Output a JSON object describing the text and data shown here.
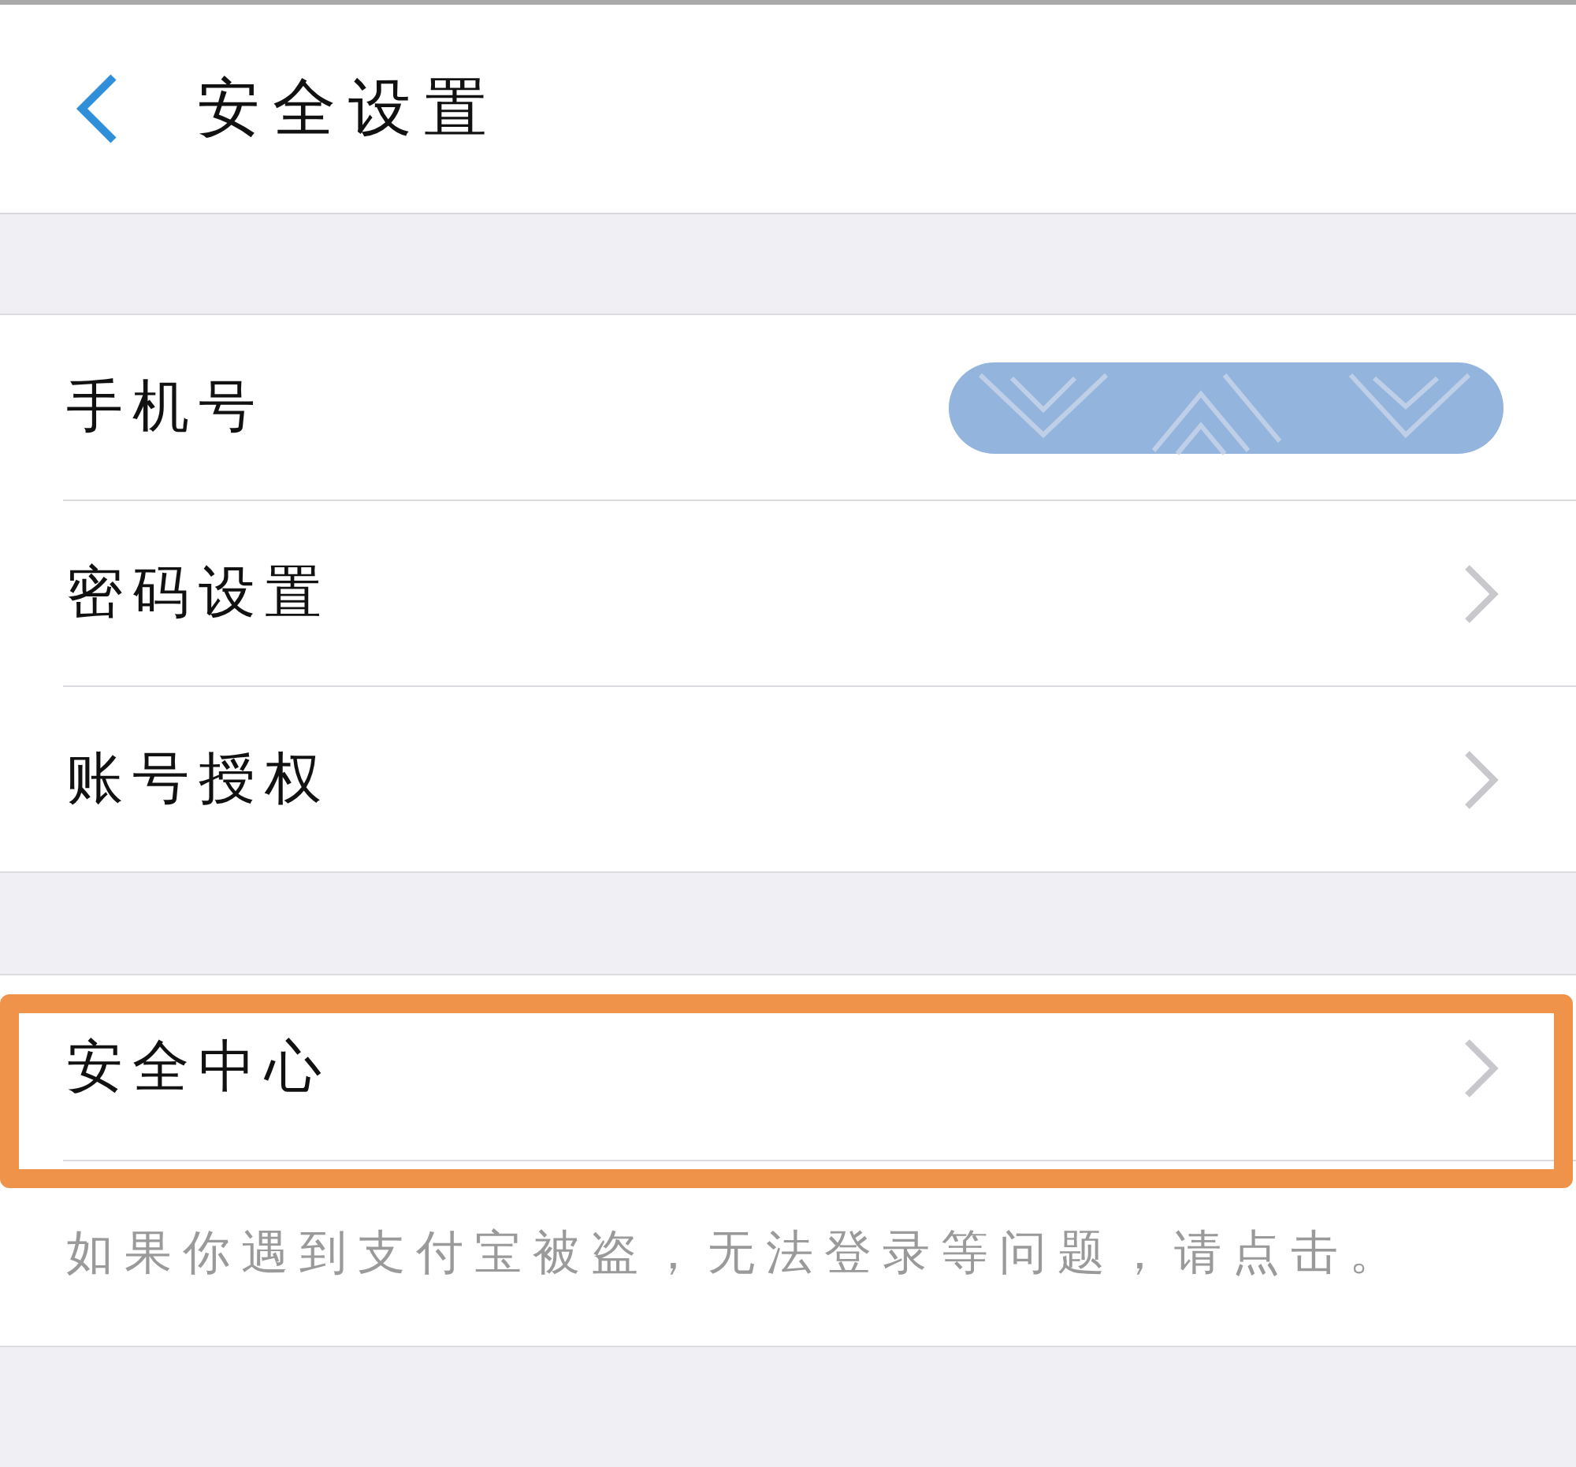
{
  "header": {
    "title": "安全设置"
  },
  "groups": [
    {
      "items": [
        {
          "label": "手机号",
          "kind": "redacted",
          "highlighted": false
        },
        {
          "label": "密码设置",
          "kind": "link",
          "highlighted": false
        },
        {
          "label": "账号授权",
          "kind": "link",
          "highlighted": false
        }
      ]
    },
    {
      "items": [
        {
          "label": "安全中心",
          "kind": "link",
          "highlighted": true
        }
      ],
      "note": "如果你遇到支付宝被盗，无法登录等问题，请点击。"
    }
  ]
}
